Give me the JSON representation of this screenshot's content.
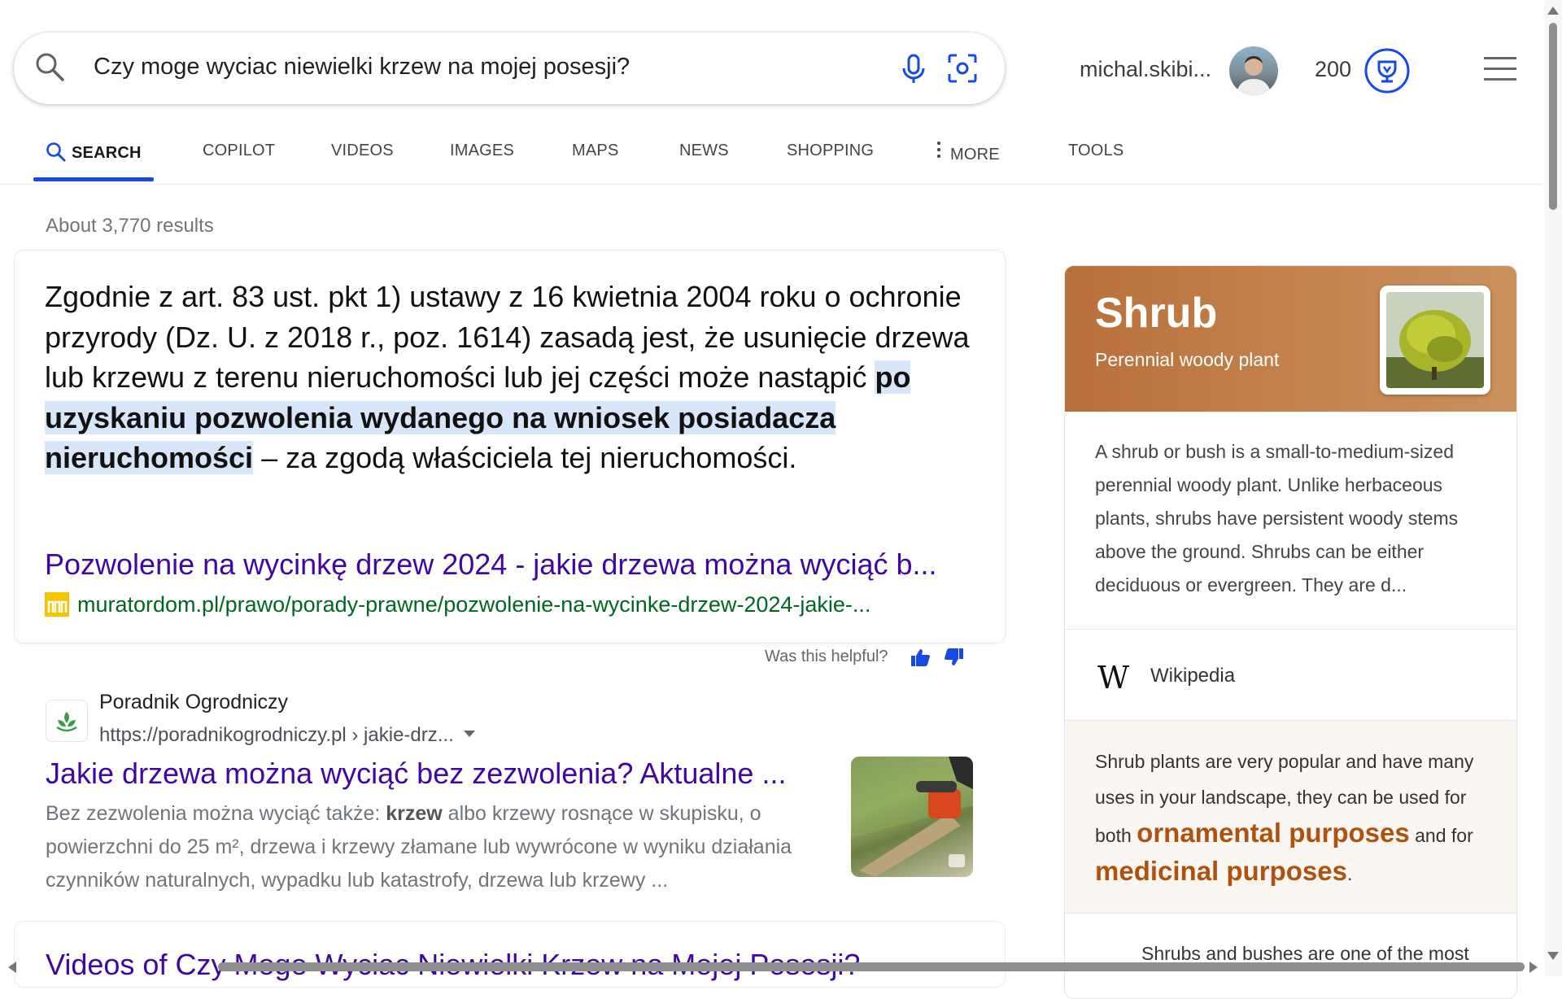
{
  "search": {
    "query": "Czy moge wyciac niewielki krzew na mojej posesji?",
    "icons": [
      "search-icon",
      "microphone-icon",
      "visual-search-icon"
    ]
  },
  "account": {
    "username": "michal.skibi...",
    "rewards_points": "200",
    "icons": [
      "avatar",
      "rewards-trophy-icon",
      "hamburger-menu-icon"
    ]
  },
  "tabs": [
    {
      "label": "SEARCH",
      "active": true
    },
    {
      "label": "COPILOT"
    },
    {
      "label": "VIDEOS"
    },
    {
      "label": "IMAGES"
    },
    {
      "label": "MAPS"
    },
    {
      "label": "NEWS"
    },
    {
      "label": "SHOPPING"
    },
    {
      "label": "MORE"
    },
    {
      "label": "TOOLS"
    }
  ],
  "results_count": "About 3,770 results",
  "answer": {
    "text_before": "Zgodnie z art. 83 ust. pkt 1) ustawy z 16 kwietnia 2004 roku o ochronie przyrody (Dz. U. z 2018 r., poz. 1614) zasadą jest, że usunięcie drzewa lub krzewu z terenu nieruchomości lub jej części może nastąpić ",
    "highlight": "po uzyskaniu pozwolenia wydanego na wniosek posiadacza nieruchomości",
    "text_after": " – za zgodą właściciela tej nieruchomości.",
    "link_title": "Pozwolenie na wycinkę drzew 2024 - jakie drzewa można wyciąć b...",
    "link_url": "muratordom.pl/prawo/porady-prawne/pozwolenie-na-wycinke-drzew-2024-jakie-...",
    "helpful_label": "Was this helpful?"
  },
  "result": {
    "site_name": "Poradnik Ogrodniczy",
    "url": "https://poradnikogrodniczy.pl › jakie-drz...",
    "title": "Jakie drzewa można wyciąć bez zezwolenia? Aktualne ...",
    "snippet_before": "Bez zezwolenia można wyciąć także: ",
    "snippet_bold": "krzew",
    "snippet_after": " albo krzewy rosnące w skupisku, o powierzchni do 25 m², drzewa i krzewy złamane lub wywrócone w wyniku działania czynników naturalnych, wypadku lub katastrofy, drzewa lub krzewy ..."
  },
  "videos_heading": "Videos of Czy Moge Wyciac Niewielki Krzew na Mojej Posesji?",
  "knowledge_panel": {
    "title": "Shrub",
    "subtitle": "Perennial woody plant",
    "description": "A shrub or bush is a small-to-medium-sized perennial woody plant. Unlike herbaceous plants, shrubs have persistent woody stems above the ground. Shrubs can be either deciduous or evergreen. They are d...",
    "source_icon": "W",
    "source_label": "Wikipedia",
    "usage_before": "Shrub plants are very popular and have many uses in your landscape, they can be used for both ",
    "usage_em1": "ornamental purposes",
    "usage_mid": " and for ",
    "usage_em2": "medicinal purposes",
    "usage_after": ".",
    "more_text": "Shrubs and bushes are one of the most"
  },
  "colors": {
    "accent": "#174ae4",
    "link_title": "#4007a2",
    "url_green": "#006621",
    "highlight_bg": "#d7e6f8",
    "kp_header": "#c07a44",
    "kp_emphasis": "#b0520f"
  }
}
